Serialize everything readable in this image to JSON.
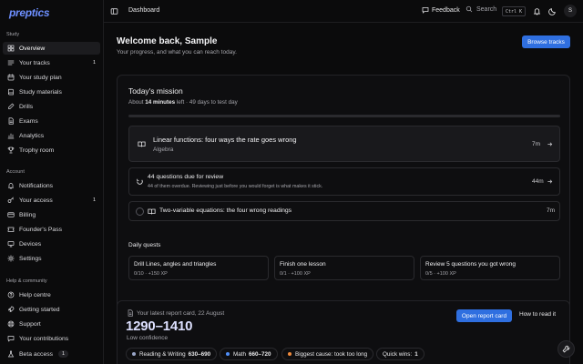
{
  "app": {
    "logo": "preptics"
  },
  "sidebar": {
    "sections": [
      {
        "label": "Study"
      },
      {
        "label": "Account"
      },
      {
        "label": "Help & community"
      }
    ],
    "study": [
      {
        "label": "Overview",
        "icon": "grid-icon",
        "active": true
      },
      {
        "label": "Your tracks",
        "icon": "tracks-icon",
        "badge": "1"
      },
      {
        "label": "Your study plan",
        "icon": "calendar-icon"
      },
      {
        "label": "Study materials",
        "icon": "book-icon"
      },
      {
        "label": "Drills",
        "icon": "pencil-icon"
      },
      {
        "label": "Exams",
        "icon": "document-icon"
      },
      {
        "label": "Analytics",
        "icon": "chart-icon"
      },
      {
        "label": "Trophy room",
        "icon": "trophy-icon"
      }
    ],
    "account": [
      {
        "label": "Notifications",
        "icon": "bell-icon"
      },
      {
        "label": "Your access",
        "icon": "key-icon",
        "badge": "1"
      },
      {
        "label": "Billing",
        "icon": "card-icon"
      },
      {
        "label": "Founder's Pass",
        "icon": "ticket-icon"
      },
      {
        "label": "Devices",
        "icon": "device-icon"
      },
      {
        "label": "Settings",
        "icon": "gear-icon"
      }
    ],
    "help": [
      {
        "label": "Help centre",
        "icon": "help-icon"
      },
      {
        "label": "Getting started",
        "icon": "rocket-icon"
      },
      {
        "label": "Support",
        "icon": "lifebuoy-icon"
      },
      {
        "label": "Your contributions",
        "icon": "chat-icon"
      }
    ],
    "beta": {
      "label": "Beta access",
      "badge": "1"
    }
  },
  "topbar": {
    "breadcrumb": "Dashboard",
    "feedback_label": "Feedback",
    "search_label": "Search",
    "search_shortcut": "Ctrl K",
    "avatar_initial": "S"
  },
  "welcome": {
    "title": "Welcome back, Sample",
    "subtitle": "Your progress, and what you can reach today.",
    "browse_label": "Browse tracks"
  },
  "mission": {
    "title": "Today's mission",
    "sub_prefix": "About ",
    "sub_minutes": "14 minutes",
    "sub_suffix": " left · 49 days to test day",
    "progress": 0.0,
    "primary": {
      "title": "Linear functions: four ways the rate goes wrong",
      "subtitle": "Algebra",
      "time": "7m"
    },
    "review": {
      "title": "44 questions due for review",
      "subtitle": "44 of them overdue. Reviewing just before you would forget is what makes it stick.",
      "time": "44m"
    },
    "small": {
      "title": "Two-variable equations: the four wrong readings",
      "time": "7m"
    }
  },
  "quests": {
    "label": "Daily quests",
    "items": [
      {
        "title": "Drill Lines, angles and triangles",
        "progress": "0/10 · +150 XP"
      },
      {
        "title": "Finish one lesson",
        "progress": "0/1 · +100 XP"
      },
      {
        "title": "Review 5 questions you got wrong",
        "progress": "0/5 · +100 XP"
      }
    ]
  },
  "report": {
    "label": "Your latest report card, 22 August",
    "score": "1290–1410",
    "confidence": "Low confidence",
    "open_label": "Open report card",
    "how_label": "How to read it",
    "pills": [
      {
        "label": "Reading & Writing",
        "value": "630–690",
        "color": "#9aa6c8"
      },
      {
        "label": "Math",
        "value": "660–720",
        "color": "#4f8ef7"
      },
      {
        "label": "Biggest cause: took too long",
        "value": "",
        "color": "#f08a3c"
      },
      {
        "label": "Quick wins:",
        "value": "1",
        "color": ""
      }
    ]
  }
}
